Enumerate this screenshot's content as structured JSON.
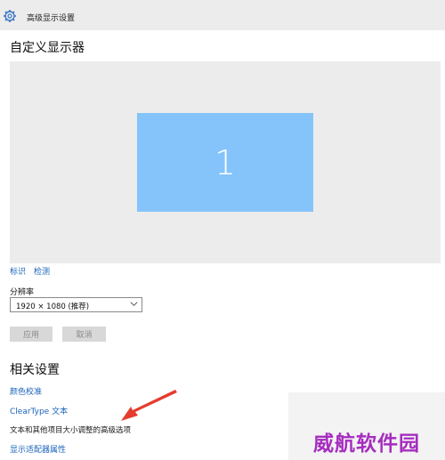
{
  "window": {
    "title": "高级显示设置",
    "icon": "gear-icon"
  },
  "display": {
    "heading": "自定义显示器",
    "monitor_number": "1",
    "monitor_color": "#84c4fa",
    "identify_label": "标识",
    "detect_label": "检测"
  },
  "resolution": {
    "label": "分辨率",
    "selected": "1920 × 1080 (推荐)"
  },
  "buttons": {
    "apply": "应用",
    "cancel": "取消"
  },
  "related": {
    "heading": "相关设置",
    "color_calibration": "颜色校准",
    "cleartype": "ClearType 文本",
    "text_sizing": "文本和其他项目大小调整的高级选项",
    "adapter_properties": "显示适配器属性"
  },
  "annotation": {
    "arrow_color": "#e53c2f"
  },
  "watermark": {
    "text": "威航软件园",
    "color": "#a62dbf"
  }
}
